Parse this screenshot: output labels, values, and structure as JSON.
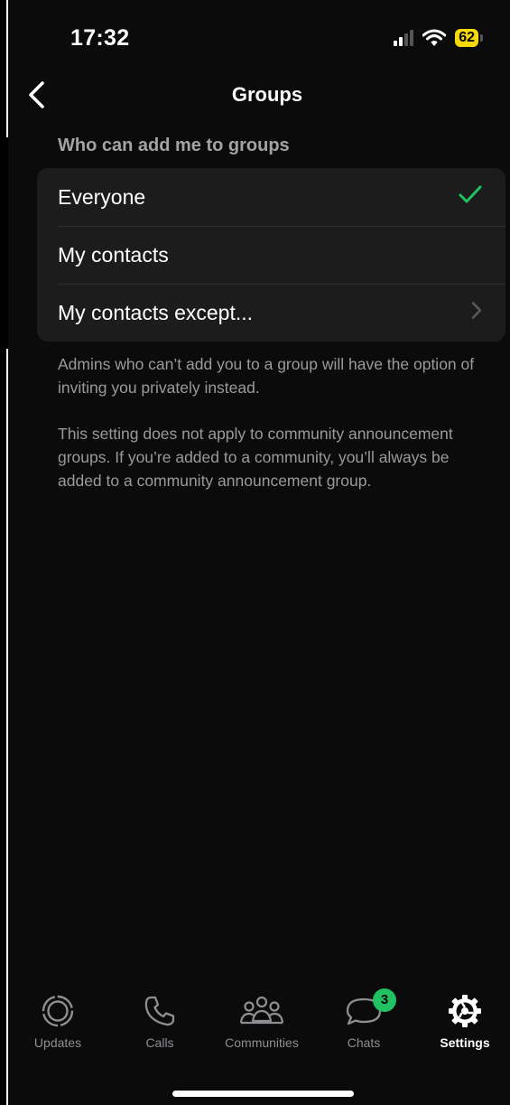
{
  "status_bar": {
    "time": "17:32",
    "battery": "62"
  },
  "nav": {
    "title": "Groups"
  },
  "section": {
    "header": "Who can add me to groups",
    "options": [
      {
        "label": "Everyone",
        "selected": true
      },
      {
        "label": "My contacts",
        "selected": false
      },
      {
        "label": "My contacts except...",
        "selected": false
      }
    ]
  },
  "footnotes": {
    "admins_note": "Admins who can’t add you to a group will have the option of inviting you privately instead.",
    "community_note": "This setting does not apply to community announcement groups. If you’re added to a community, you’ll always be added to a community announcement group."
  },
  "tabbar": {
    "tabs": [
      {
        "label": "Updates",
        "icon": "updates-icon"
      },
      {
        "label": "Calls",
        "icon": "phone-icon"
      },
      {
        "label": "Communities",
        "icon": "communities-icon"
      },
      {
        "label": "Chats",
        "icon": "chat-bubble-icon",
        "badge": "3"
      },
      {
        "label": "Settings",
        "icon": "gear-icon",
        "active": true
      }
    ]
  },
  "colors": {
    "accent": "#21c063",
    "card_bg": "#1c1c1d",
    "background": "#0b0b0b",
    "battery": "#f5d90a"
  }
}
